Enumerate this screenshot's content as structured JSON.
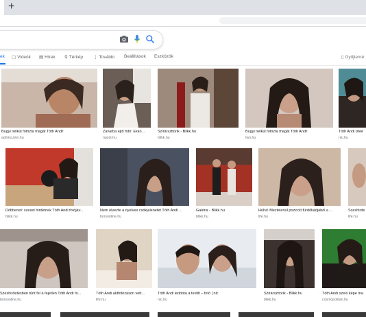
{
  "browser": {
    "new_tab": "+"
  },
  "tabs": {
    "all": "ek",
    "videos": "Videók",
    "news": "Hírek",
    "maps": "Térkép",
    "more": "További",
    "settings": "Beállítások",
    "tools": "Eszközök",
    "safesearch": "Gyűjtemé"
  },
  "results": [
    {
      "caption": "Bugyi nélkül fotózta magát Tóth Andi!",
      "source": "admira.twn.hu"
    },
    {
      "caption": "Zavarba ejtő fotó: Ekko...",
      "source": "npost.hu"
    },
    {
      "caption": "Szirárszttorik - Blikk.hu",
      "source": "blikk.hu"
    },
    {
      "caption": "Bugyi nélkül fotózta magát Tóth Andi!",
      "source": "twn.hu"
    },
    {
      "caption": "Tóth Andi izléé",
      "source": "nlc.hu"
    },
    {
      "caption": "Döbbenet: szexet hirdetnek Tóth Andi fotójáv...",
      "source": "blikk.hu"
    },
    {
      "caption": "Nem élvezte a nyelves csókjelenetet Tóth Andi ...",
      "source": "borsonline.hu"
    },
    {
      "caption": "Galéria - Blikk.hu",
      "source": "blikk.hu"
    },
    {
      "caption": "Húha! Meztelenül pozicolt fürdőkádjából a ...",
      "source": "life.hu"
    },
    {
      "caption": "Szexhirde",
      "source": "life.hu"
    },
    {
      "caption": "Szexhirdetésben tűnt fel a fejetlen Tóth Andi fo...",
      "source": "borsonline.hu"
    },
    {
      "caption": "Tóth Andi aktfotózáson vett...",
      "source": "life.hu"
    },
    {
      "caption": "Tóth Andi ledobta a textilt – fotó | nlc",
      "source": "nlc.hu"
    },
    {
      "caption": "Szirárszttorik - Blikk.hu",
      "source": "blikk.hu"
    },
    {
      "caption": "Tóth Andi szexi képe ma",
      "source": "cosmopolitan.hu"
    }
  ]
}
